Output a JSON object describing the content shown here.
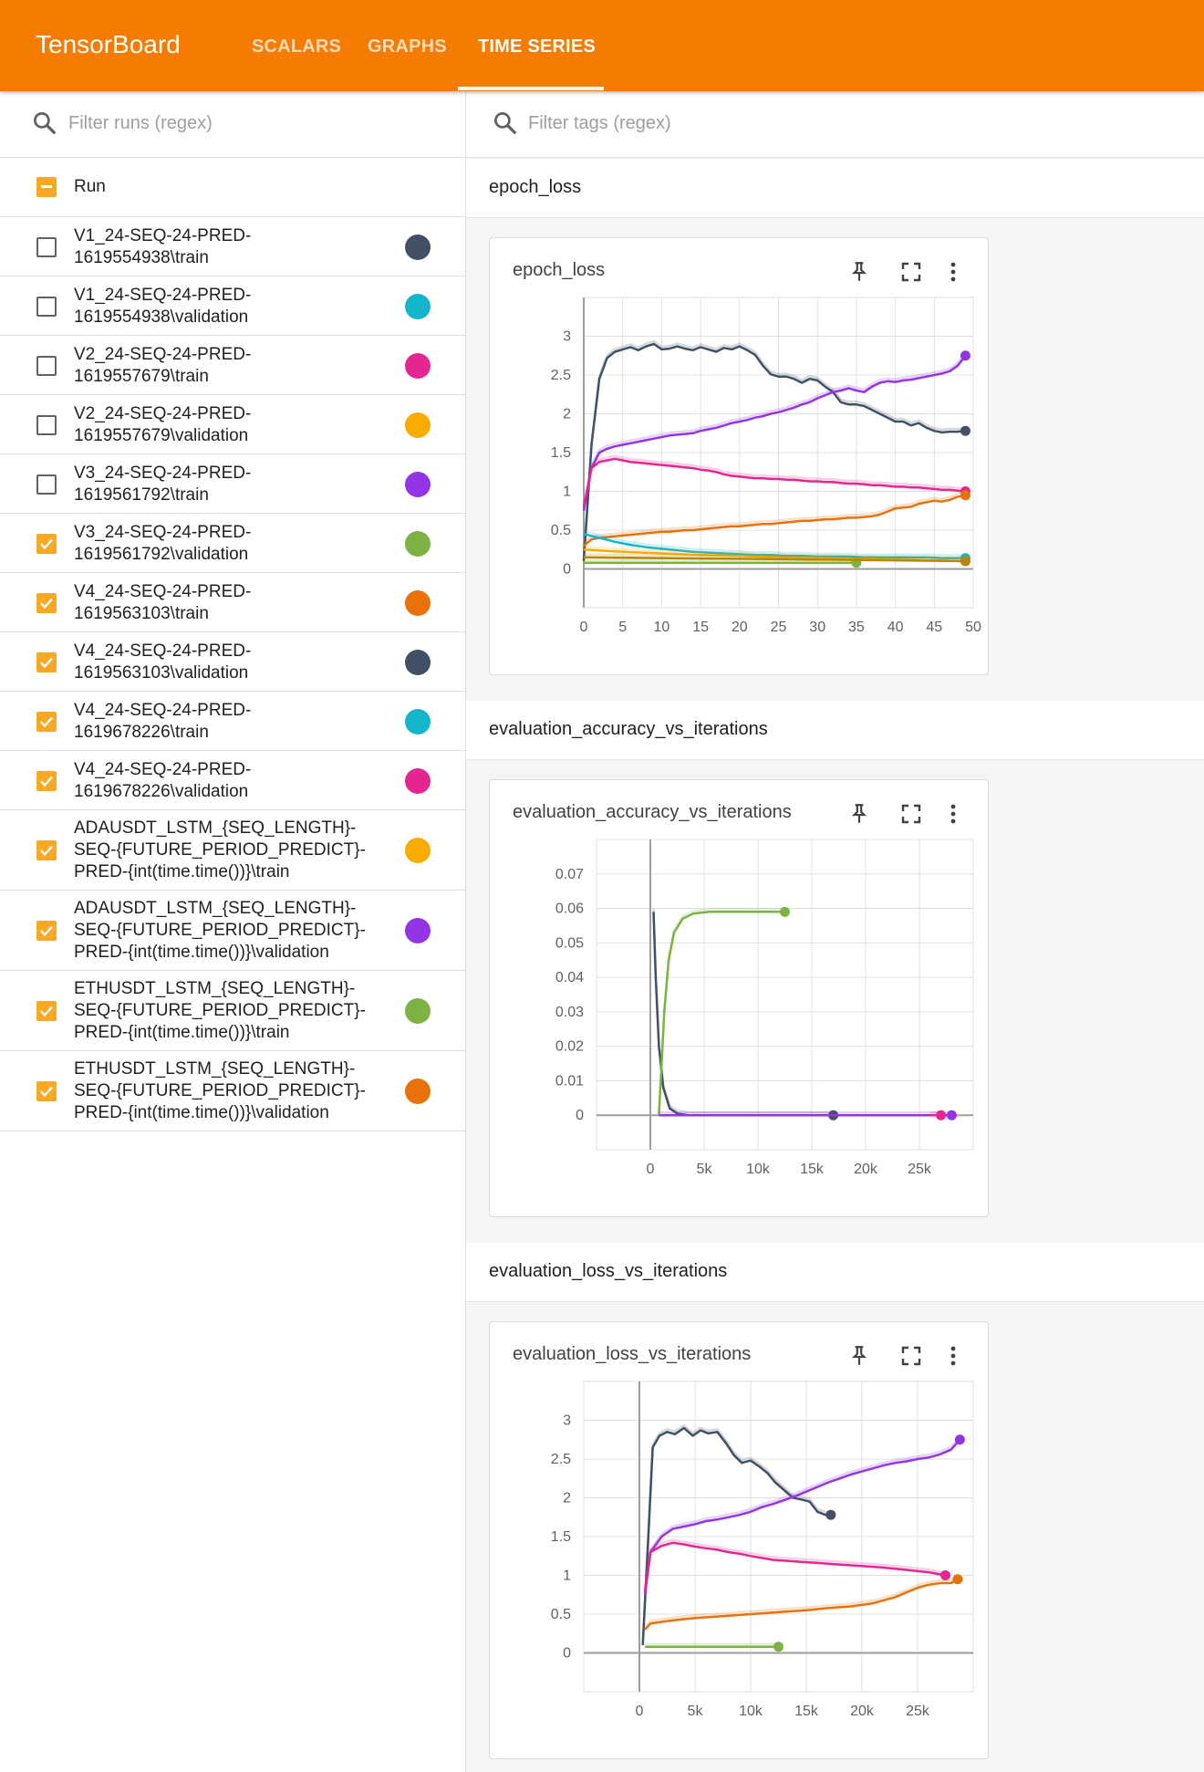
{
  "app": {
    "brand": "TensorBoard",
    "tabs": [
      "SCALARS",
      "GRAPHS",
      "TIME SERIES"
    ],
    "active_tab": "TIME SERIES",
    "accent": "#f57c00"
  },
  "runs_panel": {
    "filter_placeholder": "Filter runs (regex)",
    "header": "Run",
    "runs": [
      {
        "label": "V1_24-SEQ-24-PRED-1619554938\\train",
        "checked": false,
        "color": "#425066"
      },
      {
        "label": "V1_24-SEQ-24-PRED-1619554938\\validation",
        "checked": false,
        "color": "#12b5cb"
      },
      {
        "label": "V2_24-SEQ-24-PRED-1619557679\\train",
        "checked": false,
        "color": "#e52592"
      },
      {
        "label": "V2_24-SEQ-24-PRED-1619557679\\validation",
        "checked": false,
        "color": "#f9ab00"
      },
      {
        "label": "V3_24-SEQ-24-PRED-1619561792\\train",
        "checked": false,
        "color": "#9334e6"
      },
      {
        "label": "V3_24-SEQ-24-PRED-1619561792\\validation",
        "checked": true,
        "color": "#7cb342"
      },
      {
        "label": "V4_24-SEQ-24-PRED-1619563103\\train",
        "checked": true,
        "color": "#e8710a"
      },
      {
        "label": "V4_24-SEQ-24-PRED-1619563103\\validation",
        "checked": true,
        "color": "#425066"
      },
      {
        "label": "V4_24-SEQ-24-PRED-1619678226\\train",
        "checked": true,
        "color": "#12b5cb"
      },
      {
        "label": "V4_24-SEQ-24-PRED-1619678226\\validation",
        "checked": true,
        "color": "#e52592"
      },
      {
        "label": "ADAUSDT_LSTM_{SEQ_LENGTH}-SEQ-{FUTURE_PERIOD_PREDICT}-PRED-{int(time.time())}\\train",
        "checked": true,
        "color": "#f9ab00"
      },
      {
        "label": "ADAUSDT_LSTM_{SEQ_LENGTH}-SEQ-{FUTURE_PERIOD_PREDICT}-PRED-{int(time.time())}\\validation",
        "checked": true,
        "color": "#9334e6"
      },
      {
        "label": "ETHUSDT_LSTM_{SEQ_LENGTH}-SEQ-{FUTURE_PERIOD_PREDICT}-PRED-{int(time.time())}\\train",
        "checked": true,
        "color": "#7cb342"
      },
      {
        "label": "ETHUSDT_LSTM_{SEQ_LENGTH}-SEQ-{FUTURE_PERIOD_PREDICT}-PRED-{int(time.time())}\\validation",
        "checked": true,
        "color": "#e8710a"
      }
    ]
  },
  "main": {
    "filter_placeholder": "Filter tags (regex)",
    "groups": [
      {
        "name": "epoch_loss",
        "card_title": "epoch_loss"
      },
      {
        "name": "evaluation_accuracy_vs_iterations",
        "card_title": "evaluation_accuracy_vs_iterations"
      },
      {
        "name": "evaluation_loss_vs_iterations",
        "card_title": "evaluation_loss_vs_iterations"
      }
    ],
    "card_icons": [
      "pin-icon",
      "fullscreen-icon",
      "more-vert-icon"
    ]
  },
  "chart_data": [
    {
      "type": "line",
      "title": "epoch_loss",
      "xlim": [
        0,
        50
      ],
      "ylim": [
        -0.5,
        3.5
      ],
      "xticks": [
        0,
        5,
        10,
        15,
        20,
        25,
        30,
        35,
        40,
        45,
        50
      ],
      "yticks": [
        0,
        0.5,
        1,
        1.5,
        2,
        2.5,
        3
      ],
      "ytick_labels": [
        "0",
        "0.5",
        "1",
        "1.5",
        "2",
        "2.5",
        "3"
      ],
      "series": [
        {
          "color": "#425066",
          "x": [
            0,
            1,
            2,
            3,
            4,
            5,
            6,
            7,
            8,
            9,
            10,
            11,
            12,
            13,
            14,
            15,
            16,
            17,
            18,
            19,
            20,
            21,
            22,
            23,
            24,
            25,
            26,
            27,
            28,
            29,
            30,
            31,
            32,
            33,
            34,
            35,
            36,
            37,
            38,
            39,
            40,
            41,
            42,
            43,
            44,
            45,
            46,
            47,
            48,
            49
          ],
          "values": [
            0.1,
            1.6,
            2.45,
            2.72,
            2.8,
            2.83,
            2.86,
            2.82,
            2.87,
            2.9,
            2.83,
            2.84,
            2.87,
            2.84,
            2.82,
            2.86,
            2.83,
            2.8,
            2.85,
            2.83,
            2.87,
            2.82,
            2.76,
            2.62,
            2.51,
            2.48,
            2.48,
            2.45,
            2.4,
            2.45,
            2.43,
            2.35,
            2.28,
            2.15,
            2.12,
            2.12,
            2.1,
            2.05,
            2.0,
            1.95,
            1.9,
            1.9,
            1.85,
            1.88,
            1.82,
            1.78,
            1.76,
            1.77,
            1.77,
            1.78
          ]
        },
        {
          "color": "#9334e6",
          "x": [
            0,
            1,
            2,
            3,
            4,
            5,
            6,
            7,
            8,
            9,
            10,
            11,
            12,
            13,
            14,
            15,
            16,
            17,
            18,
            19,
            20,
            21,
            22,
            23,
            24,
            25,
            26,
            27,
            28,
            29,
            30,
            31,
            32,
            33,
            34,
            35,
            36,
            37,
            38,
            39,
            40,
            41,
            42,
            43,
            44,
            45,
            46,
            47,
            48,
            49
          ],
          "values": [
            0.75,
            1.3,
            1.5,
            1.55,
            1.58,
            1.6,
            1.62,
            1.64,
            1.66,
            1.68,
            1.7,
            1.72,
            1.73,
            1.74,
            1.75,
            1.78,
            1.8,
            1.82,
            1.85,
            1.88,
            1.9,
            1.92,
            1.95,
            1.97,
            2.0,
            2.02,
            2.05,
            2.08,
            2.12,
            2.15,
            2.2,
            2.24,
            2.28,
            2.3,
            2.33,
            2.3,
            2.28,
            2.35,
            2.4,
            2.42,
            2.41,
            2.43,
            2.44,
            2.46,
            2.48,
            2.5,
            2.52,
            2.55,
            2.62,
            2.75
          ]
        },
        {
          "color": "#e52592",
          "x": [
            0,
            1,
            2,
            3,
            4,
            5,
            6,
            7,
            8,
            9,
            10,
            11,
            12,
            13,
            14,
            15,
            16,
            17,
            18,
            19,
            20,
            21,
            22,
            23,
            24,
            25,
            26,
            27,
            28,
            29,
            30,
            31,
            32,
            33,
            34,
            35,
            36,
            37,
            38,
            39,
            40,
            41,
            42,
            43,
            44,
            45,
            46,
            47,
            48,
            49
          ],
          "values": [
            0.8,
            1.3,
            1.38,
            1.4,
            1.42,
            1.4,
            1.38,
            1.37,
            1.36,
            1.35,
            1.34,
            1.33,
            1.32,
            1.31,
            1.3,
            1.28,
            1.27,
            1.25,
            1.22,
            1.2,
            1.19,
            1.18,
            1.17,
            1.17,
            1.16,
            1.16,
            1.15,
            1.15,
            1.14,
            1.13,
            1.13,
            1.12,
            1.12,
            1.11,
            1.1,
            1.1,
            1.09,
            1.08,
            1.08,
            1.07,
            1.06,
            1.06,
            1.05,
            1.05,
            1.04,
            1.03,
            1.02,
            1.02,
            1.01,
            1.0
          ]
        },
        {
          "color": "#e8710a",
          "x": [
            0,
            1,
            2,
            3,
            4,
            5,
            6,
            7,
            8,
            9,
            10,
            11,
            12,
            13,
            14,
            15,
            16,
            17,
            18,
            19,
            20,
            21,
            22,
            23,
            24,
            25,
            26,
            27,
            28,
            29,
            30,
            31,
            32,
            33,
            34,
            35,
            36,
            37,
            38,
            39,
            40,
            41,
            42,
            43,
            44,
            45,
            46,
            47,
            48,
            49
          ],
          "values": [
            0.3,
            0.38,
            0.4,
            0.41,
            0.42,
            0.43,
            0.44,
            0.45,
            0.46,
            0.47,
            0.48,
            0.48,
            0.49,
            0.5,
            0.5,
            0.51,
            0.52,
            0.53,
            0.54,
            0.55,
            0.55,
            0.56,
            0.57,
            0.58,
            0.58,
            0.59,
            0.6,
            0.61,
            0.62,
            0.62,
            0.63,
            0.64,
            0.64,
            0.65,
            0.66,
            0.66,
            0.67,
            0.68,
            0.7,
            0.74,
            0.78,
            0.79,
            0.8,
            0.84,
            0.86,
            0.88,
            0.87,
            0.89,
            0.93,
            0.95
          ]
        },
        {
          "color": "#12b5cb",
          "x": [
            0,
            2,
            4,
            6,
            8,
            10,
            12,
            14,
            16,
            18,
            20,
            22,
            24,
            26,
            28,
            30,
            32,
            34,
            36,
            38,
            40,
            42,
            44,
            46,
            48,
            49
          ],
          "values": [
            0.45,
            0.4,
            0.35,
            0.31,
            0.28,
            0.26,
            0.24,
            0.22,
            0.21,
            0.2,
            0.19,
            0.18,
            0.18,
            0.17,
            0.17,
            0.16,
            0.16,
            0.16,
            0.15,
            0.15,
            0.15,
            0.15,
            0.15,
            0.14,
            0.14,
            0.14
          ]
        },
        {
          "color": "#f9ab00",
          "x": [
            0,
            5,
            10,
            15,
            20,
            25,
            30,
            35,
            40,
            45,
            49
          ],
          "values": [
            0.25,
            0.22,
            0.2,
            0.18,
            0.17,
            0.15,
            0.14,
            0.13,
            0.12,
            0.11,
            0.1
          ]
        },
        {
          "color": "#7cb342",
          "x": [
            0,
            5,
            10,
            15,
            20,
            25,
            30,
            35
          ],
          "values": [
            0.08,
            0.08,
            0.08,
            0.08,
            0.08,
            0.08,
            0.08,
            0.08
          ]
        },
        {
          "color": "#b8860b",
          "x": [
            0,
            10,
            20,
            30,
            40,
            49
          ],
          "values": [
            0.15,
            0.14,
            0.13,
            0.12,
            0.11,
            0.1
          ]
        }
      ]
    },
    {
      "type": "line",
      "title": "evaluation_accuracy_vs_iterations",
      "xlim": [
        -5000,
        30000
      ],
      "ylim": [
        -0.01,
        0.08
      ],
      "xticks": [
        0,
        5000,
        10000,
        15000,
        20000,
        25000
      ],
      "xtick_labels": [
        "0",
        "5k",
        "10k",
        "15k",
        "20k",
        "25k"
      ],
      "yticks": [
        0,
        0.01,
        0.02,
        0.03,
        0.04,
        0.05,
        0.06,
        0.07
      ],
      "ytick_labels": [
        "0",
        "0.01",
        "0.02",
        "0.03",
        "0.04",
        "0.05",
        "0.06",
        "0.07"
      ],
      "series": [
        {
          "color": "#425066",
          "x": [
            300,
            500,
            800,
            1200,
            1800,
            2500,
            3500,
            5000,
            10000,
            17000
          ],
          "values": [
            0.059,
            0.04,
            0.02,
            0.008,
            0.002,
            0.0005,
            0,
            0,
            0,
            0
          ]
        },
        {
          "color": "#7cb342",
          "x": [
            800,
            1000,
            1300,
            1700,
            2200,
            3000,
            4000,
            5500,
            7000,
            9000,
            12500
          ],
          "values": [
            0,
            0.012,
            0.03,
            0.045,
            0.053,
            0.057,
            0.0585,
            0.059,
            0.059,
            0.059,
            0.059
          ]
        },
        {
          "color": "#9334e6",
          "x": [
            800,
            5000,
            10000,
            15000,
            20000,
            25000,
            28000
          ],
          "values": [
            0,
            0,
            0,
            0,
            0,
            0,
            0
          ]
        },
        {
          "color": "#e52592",
          "x": [
            26000,
            27000
          ],
          "values": [
            0,
            0
          ]
        }
      ]
    },
    {
      "type": "line",
      "title": "evaluation_loss_vs_iterations",
      "xlim": [
        -5000,
        30000
      ],
      "ylim": [
        -0.5,
        3.5
      ],
      "xticks": [
        0,
        5000,
        10000,
        15000,
        20000,
        25000
      ],
      "xtick_labels": [
        "0",
        "5k",
        "10k",
        "15k",
        "20k",
        "25k"
      ],
      "yticks": [
        0,
        0.5,
        1,
        1.5,
        2,
        2.5,
        3
      ],
      "ytick_labels": [
        "0",
        "0.5",
        "1",
        "1.5",
        "2",
        "2.5",
        "3"
      ],
      "series": [
        {
          "color": "#425066",
          "x": [
            300,
            800,
            1200,
            1800,
            2500,
            3200,
            4000,
            4800,
            5500,
            6200,
            7000,
            7800,
            8500,
            9200,
            10000,
            10800,
            11500,
            12200,
            13000,
            13800,
            14500,
            15300,
            16000,
            16700,
            17200
          ],
          "values": [
            0.1,
            1.5,
            2.65,
            2.8,
            2.85,
            2.82,
            2.9,
            2.8,
            2.87,
            2.83,
            2.85,
            2.7,
            2.55,
            2.45,
            2.48,
            2.4,
            2.32,
            2.2,
            2.1,
            2.0,
            1.98,
            1.95,
            1.82,
            1.78,
            1.78
          ]
        },
        {
          "color": "#9334e6",
          "x": [
            500,
            1000,
            2000,
            3000,
            4000,
            5000,
            6000,
            7000,
            8000,
            9000,
            10000,
            11000,
            12000,
            13000,
            14000,
            15000,
            16000,
            17000,
            18000,
            19000,
            20000,
            21000,
            22000,
            23000,
            24000,
            25000,
            26000,
            27000,
            28000,
            28800
          ],
          "values": [
            0.75,
            1.3,
            1.5,
            1.6,
            1.63,
            1.66,
            1.7,
            1.72,
            1.75,
            1.78,
            1.82,
            1.88,
            1.92,
            1.97,
            2.02,
            2.08,
            2.14,
            2.2,
            2.25,
            2.3,
            2.34,
            2.38,
            2.42,
            2.45,
            2.47,
            2.5,
            2.52,
            2.56,
            2.62,
            2.75
          ]
        },
        {
          "color": "#e52592",
          "x": [
            500,
            1000,
            2000,
            3000,
            4000,
            5000,
            6000,
            7000,
            8000,
            9000,
            10000,
            12000,
            14000,
            16000,
            18000,
            20000,
            22000,
            24000,
            26000,
            27500
          ],
          "values": [
            0.8,
            1.3,
            1.38,
            1.42,
            1.4,
            1.37,
            1.35,
            1.33,
            1.3,
            1.28,
            1.25,
            1.2,
            1.18,
            1.16,
            1.14,
            1.12,
            1.1,
            1.07,
            1.04,
            1.0
          ]
        },
        {
          "color": "#e8710a",
          "x": [
            500,
            1000,
            3000,
            5000,
            7000,
            9000,
            11000,
            13000,
            15000,
            17000,
            19000,
            21000,
            22000,
            23000,
            24000,
            25000,
            26000,
            27000,
            28000,
            28600
          ],
          "values": [
            0.3,
            0.38,
            0.42,
            0.45,
            0.47,
            0.49,
            0.51,
            0.53,
            0.55,
            0.58,
            0.6,
            0.64,
            0.68,
            0.72,
            0.78,
            0.84,
            0.88,
            0.9,
            0.9,
            0.95
          ]
        },
        {
          "color": "#7cb342",
          "x": [
            500,
            3000,
            6000,
            9000,
            12500
          ],
          "values": [
            0.08,
            0.08,
            0.08,
            0.08,
            0.08
          ]
        }
      ]
    }
  ]
}
